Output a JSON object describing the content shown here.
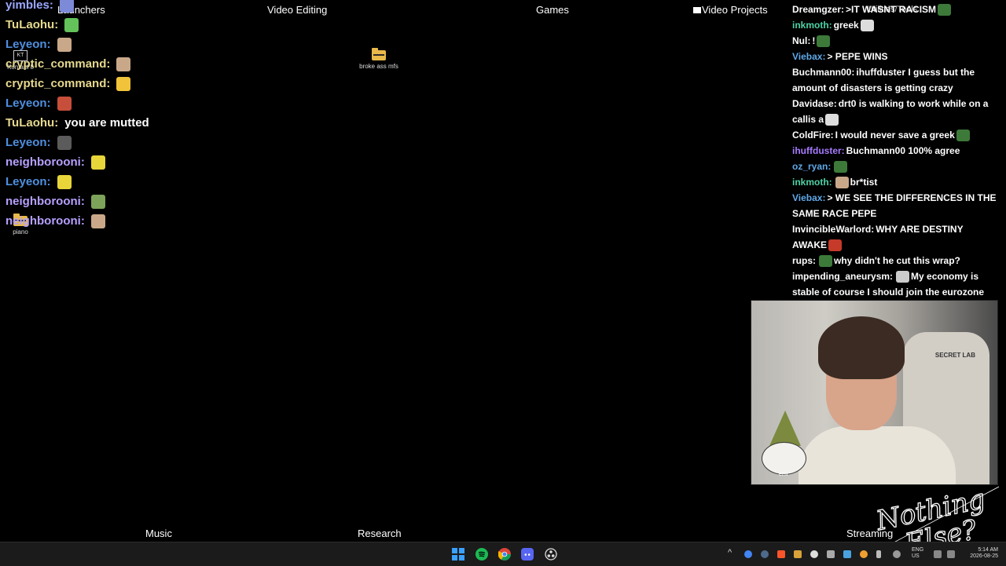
{
  "desktop": {
    "groups_top": [
      {
        "label": "Launchers"
      },
      {
        "label": "Video Editing"
      },
      {
        "label": "Games"
      },
      {
        "label": "Video Projects"
      },
      {
        "label": "Utilities/Tools"
      }
    ],
    "groups_bottom": [
      {
        "label": "Music"
      },
      {
        "label": "Research"
      },
      {
        "label": "Streaming"
      }
    ],
    "icons": [
      {
        "label": "Kontakt 8",
        "kind": "app"
      },
      {
        "label": "broke ass mfs",
        "kind": "folder"
      },
      {
        "label": "piano",
        "kind": "folder"
      }
    ]
  },
  "left_chat": [
    {
      "user": "yimbles:",
      "color": "#9aa8ff",
      "text": ""
    },
    {
      "user": "TuLaohu:",
      "color": "#e7d98f",
      "text": ""
    },
    {
      "user": "Leyeon:",
      "color": "#4f8fe0",
      "text": ""
    },
    {
      "user": "cryptic_command:",
      "color": "#e7d98f",
      "text": ""
    },
    {
      "user": "cryptic_command:",
      "color": "#e7d98f",
      "text": ""
    },
    {
      "user": "Leyeon:",
      "color": "#4f8fe0",
      "text": ""
    },
    {
      "user": "TuLaohu:",
      "color": "#e7d98f",
      "text": "you are mutted"
    },
    {
      "user": "Leyeon:",
      "color": "#4f8fe0",
      "text": ""
    },
    {
      "user": "neighborooni:",
      "color": "#b6a0ff",
      "text": ""
    },
    {
      "user": "Leyeon:",
      "color": "#4f8fe0",
      "text": ""
    },
    {
      "user": "neighborooni:",
      "color": "#b6a0ff",
      "text": ""
    },
    {
      "user": "neighborooni:",
      "color": "#b6a0ff",
      "text": ""
    }
  ],
  "right_chat": [
    {
      "user": "Dreamgzer:",
      "color": "#ffffff",
      "text": ">IT WASNT RACISM"
    },
    {
      "user": "inkmoth:",
      "color": "#4fd1a5",
      "text": "greek"
    },
    {
      "user": "Nul:",
      "color": "#ffffff",
      "text": "!"
    },
    {
      "user": "Viebax:",
      "color": "#5fa8e8",
      "text": "> PEPE WINS"
    },
    {
      "user": "Buchmann00:",
      "color": "#ffffff",
      "text": "ihuffduster I guess but the amount of disasters is getting crazy"
    },
    {
      "user": "Davidase:",
      "color": "#ffffff",
      "text": "drt0 is walking to work while on a callis a"
    },
    {
      "user": "ColdFire:",
      "color": "#ffffff",
      "text": "I would never save a greek"
    },
    {
      "user": "ihuffduster:",
      "color": "#a77bff",
      "text": "Buchmann00 100% agree"
    },
    {
      "user": "oz_ryan:",
      "color": "#5fa8e8",
      "text": ""
    },
    {
      "user": "inkmoth:",
      "color": "#4fd1a5",
      "text": "br*tist"
    },
    {
      "user": "Viebax:",
      "color": "#5fa8e8",
      "text": "> WE SEE THE DIFFERENCES IN THE SAME RACE PEPE"
    },
    {
      "user": "InvincibleWarlord:",
      "color": "#ffffff",
      "text": "WHY ARE DESTINY AWAKE"
    },
    {
      "user": "rups:",
      "color": "#ffffff",
      "text": "why didn't he cut this wrap?"
    },
    {
      "user": "impending_aneurysm:",
      "color": "#ffffff",
      "text": "My economy is stable of course I should join the eurozone"
    }
  ],
  "webcam": {
    "overlay_label": "emi",
    "chair_brand": "SECRET LAB"
  },
  "brand_logo": {
    "line1": "Nothing",
    "line2": "Else?"
  },
  "taskbar": {
    "pinned": [
      {
        "name": "windows-start"
      },
      {
        "name": "spotify"
      },
      {
        "name": "chrome"
      },
      {
        "name": "discord"
      },
      {
        "name": "obs"
      }
    ],
    "language": "ENG",
    "region": "US",
    "time": "5:14 AM",
    "date": "2026-08-25",
    "colors": {
      "bg": "#1b1b1b",
      "start": "#3aa0ff",
      "spotify": "#1db954",
      "discord": "#5865f2"
    }
  }
}
